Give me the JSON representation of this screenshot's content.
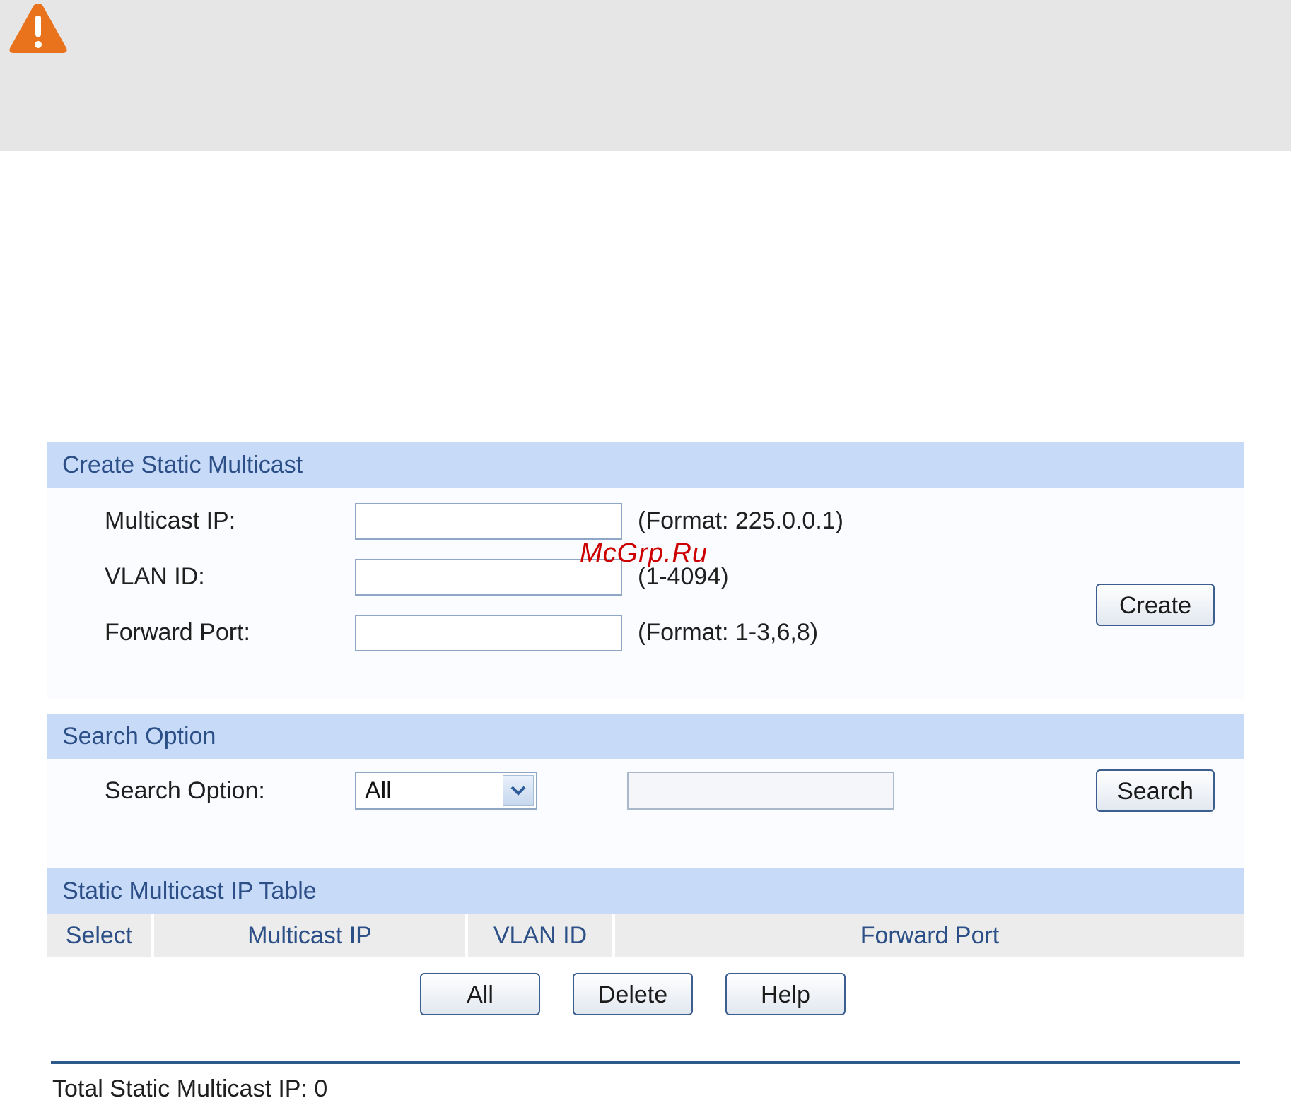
{
  "watermark": "McGrp.Ru",
  "create_section": {
    "title": "Create Static Multicast",
    "fields": [
      {
        "label": "Multicast IP:",
        "value": "",
        "hint": "(Format: 225.0.0.1)"
      },
      {
        "label": "VLAN ID:",
        "value": "",
        "hint": "(1-4094)"
      },
      {
        "label": "Forward Port:",
        "value": "",
        "hint": "(Format: 1-3,6,8)"
      }
    ],
    "create_label": "Create"
  },
  "search_section": {
    "title": "Search Option",
    "label": "Search Option:",
    "selected": "All",
    "text_value": "",
    "search_label": "Search"
  },
  "table_section": {
    "title": "Static Multicast IP Table",
    "columns": [
      "Select",
      "Multicast IP",
      "VLAN ID",
      "Forward Port"
    ],
    "rows": [],
    "buttons": [
      "All",
      "Delete",
      "Help"
    ]
  },
  "footer": {
    "total_label": "Total Static Multicast IP: 0"
  },
  "colors": {
    "header_bg": "#c7daf8",
    "header_text": "#2b4f86",
    "warning_orange": "#e8731c"
  },
  "icons": {
    "warning": "warning-triangle-icon",
    "dropdown": "chevron-down-icon"
  }
}
